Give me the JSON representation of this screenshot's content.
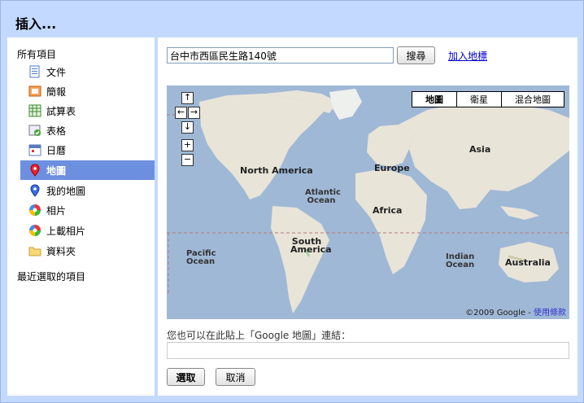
{
  "dialog": {
    "title": "插入..."
  },
  "sidebar": {
    "all_items": "所有項目",
    "recent": "最近選取的項目",
    "items": [
      {
        "label": "文件",
        "icon": "document-icon"
      },
      {
        "label": "簡報",
        "icon": "presentation-icon"
      },
      {
        "label": "試算表",
        "icon": "spreadsheet-icon"
      },
      {
        "label": "表格",
        "icon": "form-icon"
      },
      {
        "label": "日曆",
        "icon": "calendar-icon"
      },
      {
        "label": "地圖",
        "icon": "map-pin-icon",
        "selected": true
      },
      {
        "label": "我的地圖",
        "icon": "my-map-pin-icon"
      },
      {
        "label": "相片",
        "icon": "photos-icon"
      },
      {
        "label": "上載相片",
        "icon": "upload-photos-icon"
      },
      {
        "label": "資料夾",
        "icon": "folder-icon"
      }
    ]
  },
  "search": {
    "value": "台中市西區民生路140號",
    "button": "搜尋",
    "add_marker": "加入地標"
  },
  "map": {
    "types": [
      "地圖",
      "衛星",
      "混合地圖"
    ],
    "selected_type": "地圖",
    "labels": {
      "north_america": "North America",
      "atlantic": "Atlantic Ocean",
      "europe": "Europe",
      "asia": "Asia",
      "africa": "Africa",
      "south_america": "South America",
      "pacific": "Pacific Ocean",
      "indian": "Indian Ocean",
      "australia": "Australia"
    },
    "copyright": "©2009 Google - ",
    "terms": "使用條款"
  },
  "paste": {
    "hint": "您也可以在此貼上「Google 地圖」連結：",
    "value": ""
  },
  "actions": {
    "select": "選取",
    "cancel": "取消"
  },
  "colors": {
    "accent": "#6d8fe0",
    "frame": "#c3d9ff",
    "ocean": "#9fb8d6",
    "land": "#e8e4d8"
  }
}
